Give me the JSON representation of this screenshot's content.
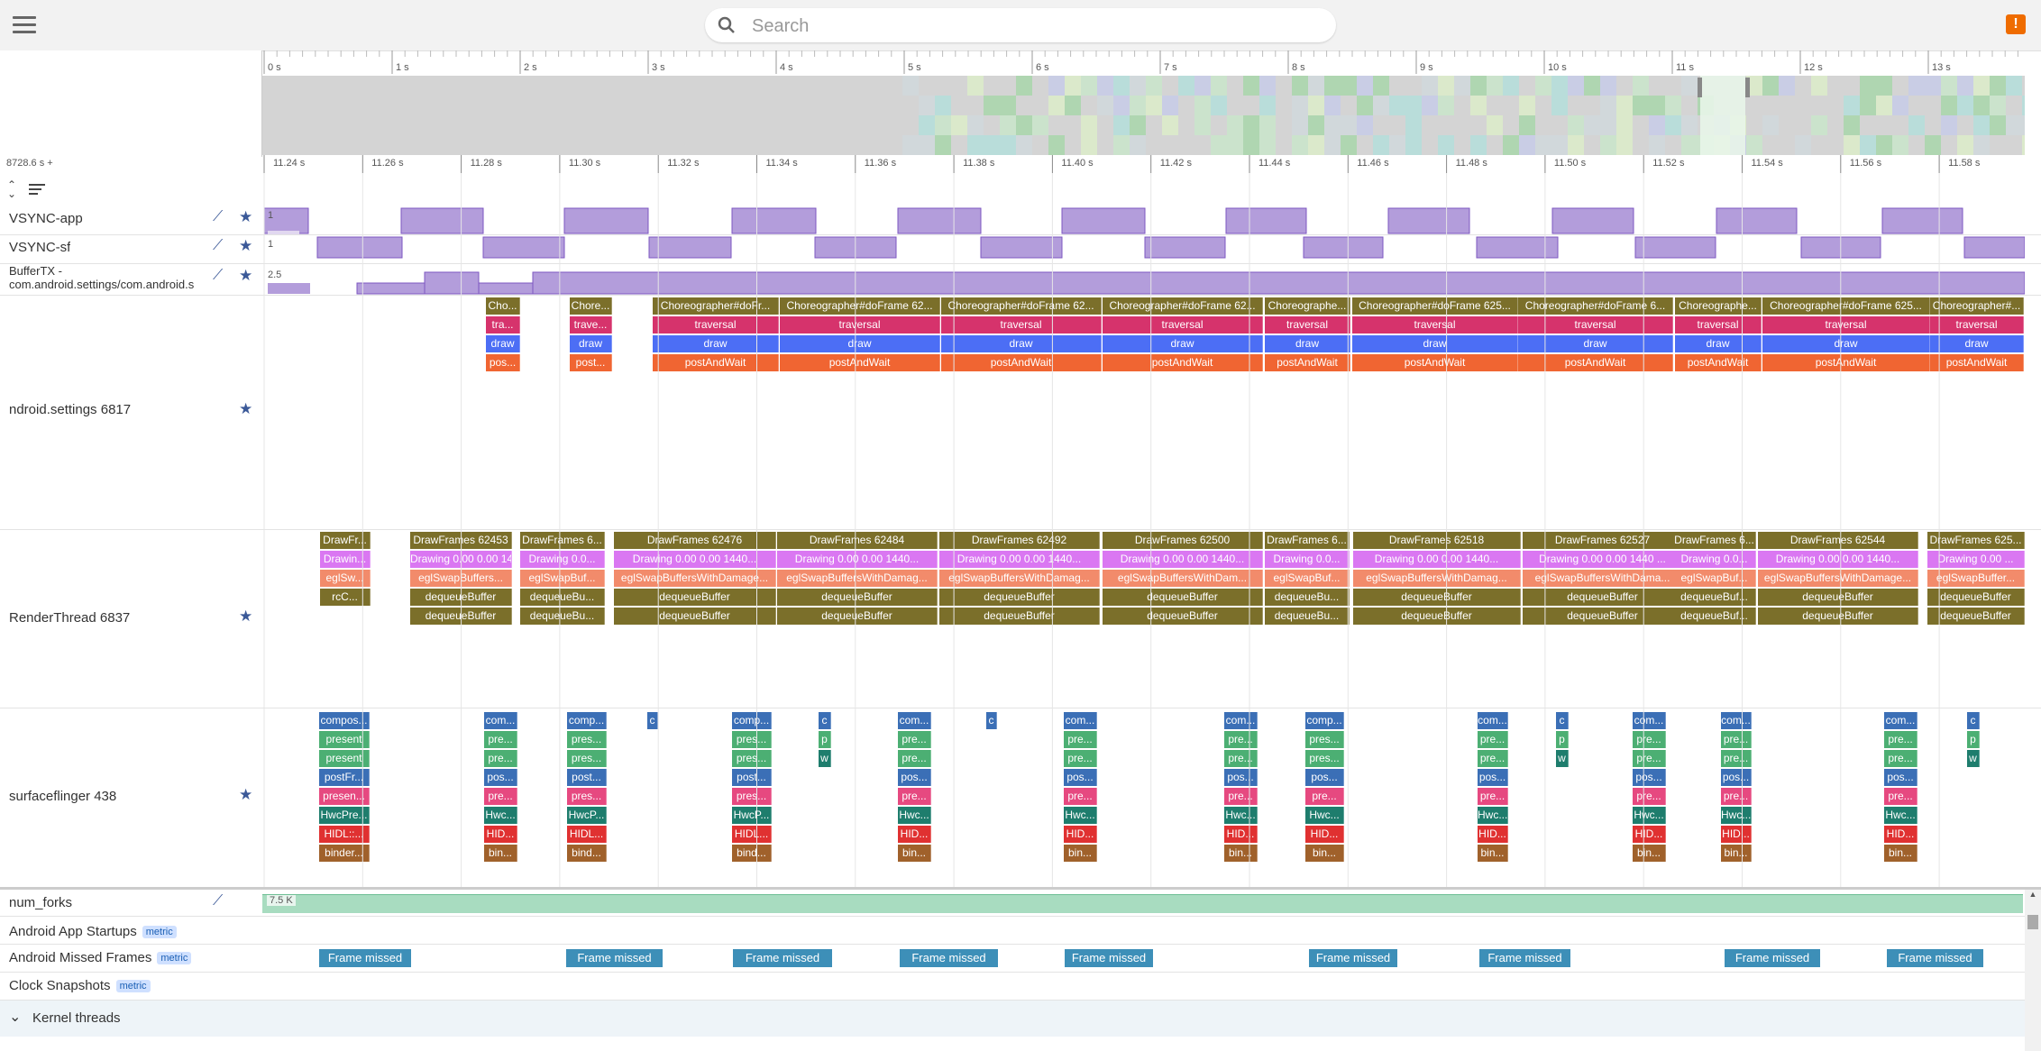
{
  "search": {
    "placeholder": "Search"
  },
  "alert_icon": "!",
  "overview": {
    "ticks": [
      "0 s",
      "1 s",
      "2 s",
      "3 s",
      "4 s",
      "5 s",
      "6 s",
      "7 s",
      "8 s",
      "9 s",
      "10 s",
      "11 s",
      "12 s",
      "13 s"
    ]
  },
  "timeline": {
    "offset": "8728.6 s +",
    "ticks": [
      "11.24 s",
      "11.26 s",
      "11.28 s",
      "11.30 s",
      "11.32 s",
      "11.34 s",
      "11.36 s",
      "11.38 s",
      "11.40 s",
      "11.42 s",
      "11.44 s",
      "11.46 s",
      "11.48 s",
      "11.50 s",
      "11.52 s",
      "11.54 s",
      "11.56 s",
      "11.58 s"
    ]
  },
  "tracks": {
    "vsync_app": {
      "label": "VSYNC-app",
      "value": "1"
    },
    "vsync_sf": {
      "label": "VSYNC-sf",
      "value": "1"
    },
    "buffertx": {
      "label": "BufferTX - com.android.settings/com.android.s",
      "value": "2.5"
    },
    "settings": {
      "label": "ndroid.settings 6817"
    },
    "renderthread": {
      "label": "RenderThread 6837"
    },
    "surfaceflinger": {
      "label": "surfaceflinger 438"
    },
    "num_forks": {
      "label": "num_forks",
      "value": "7.5 K"
    },
    "app_startups": {
      "label": "Android App Startups",
      "badge": "metric"
    },
    "missed_frames": {
      "label": "Android Missed Frames",
      "badge": "metric",
      "frame_label": "Frame missed"
    },
    "clock_snapshots": {
      "label": "Clock Snapshots",
      "badge": "metric"
    },
    "kernel_threads": {
      "label": "Kernel threads"
    }
  },
  "main_thread_slices": [
    {
      "l": [
        "Cho...",
        "tra...",
        "draw",
        "pos..."
      ]
    },
    {
      "l": [
        "Chore...",
        "trave...",
        "draw",
        "post..."
      ]
    },
    {
      "l": [
        "Choreographer#doFr...",
        "traversal",
        "draw",
        "postAndWait"
      ]
    },
    {
      "l": [
        "Choreographer#doFrame 62...",
        "traversal",
        "draw",
        "postAndWait"
      ]
    },
    {
      "l": [
        "Choreographer#doFrame 62...",
        "traversal",
        "draw",
        "postAndWait"
      ]
    },
    {
      "l": [
        "Choreographer#doFrame 62...",
        "traversal",
        "draw",
        "postAndWait"
      ]
    },
    {
      "l": [
        "Choreographe...",
        "traversal",
        "draw",
        "postAndWait"
      ]
    },
    {
      "l": [
        "Choreographer#doFrame 625...",
        "traversal",
        "draw",
        "postAndWait"
      ]
    },
    {
      "l": [
        "Choreographer#doFrame 6...",
        "traversal",
        "draw",
        "postAndWait"
      ]
    },
    {
      "l": [
        "Choreographe...",
        "traversal",
        "draw",
        "postAndWait"
      ]
    },
    {
      "l": [
        "Choreographer#doFrame 625...",
        "traversal",
        "draw",
        "postAndWait"
      ]
    },
    {
      "l": [
        "Choreographer#...",
        "traversal",
        "draw",
        "postAndWait"
      ]
    }
  ],
  "render_slices": [
    {
      "l": [
        "DrawFr...",
        "Drawin...",
        "eglSw...",
        "rcC..."
      ]
    },
    {
      "l": [
        "DrawFrames 62453",
        "Drawing  0.00  0.00 1440...",
        "eglSwapBuffers...",
        "dequeueBuffer",
        "dequeueBuffer"
      ]
    },
    {
      "l": [
        "DrawFrames 6...",
        "Drawing  0.0...",
        "eglSwapBuf...",
        "dequeueBu...",
        "dequeueBu..."
      ]
    },
    {
      "l": [
        "DrawFrames 62476",
        "Drawing  0.00  0.00 1440...",
        "eglSwapBuffersWithDamage...",
        "dequeueBuffer",
        "dequeueBuffer"
      ]
    },
    {
      "l": [
        "DrawFrames 62484",
        "Drawing  0.00  0.00 1440...",
        "eglSwapBuffersWithDamag...",
        "dequeueBuffer",
        "dequeueBuffer"
      ]
    },
    {
      "l": [
        "DrawFrames 62492",
        "Drawing  0.00  0.00 1440...",
        "eglSwapBuffersWithDamag...",
        "dequeueBuffer",
        "dequeueBuffer"
      ]
    },
    {
      "l": [
        "DrawFrames 62500",
        "Drawing  0.00  0.00 1440...",
        "eglSwapBuffersWithDam...",
        "dequeueBuffer",
        "dequeueBuffer"
      ]
    },
    {
      "l": [
        "DrawFrames 6...",
        "Drawing  0.0...",
        "eglSwapBuf...",
        "dequeueBu...",
        "dequeueBu..."
      ]
    },
    {
      "l": [
        "DrawFrames 62518",
        "Drawing  0.00  0.00 1440...",
        "eglSwapBuffersWithDamag...",
        "dequeueBuffer",
        "dequeueBuffer"
      ]
    },
    {
      "l": [
        "DrawFrames 62527",
        "Drawing  0.00  0.00 1440 ...",
        "eglSwapBuffersWithDama...",
        "dequeueBuffer",
        "dequeueBuffer"
      ]
    },
    {
      "l": [
        "DrawFrames 6...",
        "Drawing  0.0...",
        "eglSwapBuf...",
        "dequeueBuf...",
        "dequeueBuf..."
      ]
    },
    {
      "l": [
        "DrawFrames 62544",
        "Drawing  0.00  0.00 1440...",
        "eglSwapBuffersWithDamage...",
        "dequeueBuffer",
        "dequeueBuffer"
      ]
    },
    {
      "l": [
        "DrawFrames 625...",
        "Drawing  0.00 ...",
        "eglSwapBuffer...",
        "dequeueBuffer",
        "dequeueBuffer"
      ]
    }
  ],
  "sf_slices": [
    {
      "l": [
        "compos...",
        "present",
        "present",
        "postFr...",
        "presen...",
        "HwcPre...",
        "HIDL::...",
        "binder..."
      ]
    },
    {
      "l": [
        "com...",
        "pre...",
        "pre...",
        "pos...",
        "pre...",
        "Hwc...",
        "HID...",
        "bin..."
      ]
    },
    {
      "l": [
        "comp...",
        "pres...",
        "pres...",
        "post...",
        "pres...",
        "HwcP...",
        "HIDL...",
        "bind..."
      ]
    },
    {
      "l": [
        "comp...",
        "pres...",
        "pres...",
        "post...",
        "pres...",
        "HwcP...",
        "HIDL...",
        "bind..."
      ]
    },
    {
      "l": [
        "com...",
        "pre...",
        "pre...",
        "pos...",
        "pre...",
        "Hwc...",
        "HID...",
        "bin..."
      ]
    },
    {
      "l": [
        "com...",
        "pre...",
        "pre...",
        "pos...",
        "pre...",
        "Hwc...",
        "HID...",
        "bin..."
      ]
    },
    {
      "l": [
        "com...",
        "pre...",
        "pre...",
        "pos...",
        "pre...",
        "Hwc...",
        "HID...",
        "bin..."
      ]
    },
    {
      "l": [
        "comp...",
        "pres...",
        "pres...",
        "pos...",
        "pre...",
        "Hwc...",
        "HID...",
        "bin..."
      ]
    },
    {
      "l": [
        "com...",
        "pre...",
        "pre...",
        "pos...",
        "pre...",
        "Hwc...",
        "HID...",
        "bin..."
      ]
    },
    {
      "l": [
        "com...",
        "pre...",
        "pre...",
        "pos...",
        "pre...",
        "Hwc...",
        "HID...",
        "bin..."
      ]
    },
    {
      "l": [
        "com...",
        "pre...",
        "pre...",
        "pos...",
        "pre...",
        "Hwc...",
        "HID...",
        "bin..."
      ]
    },
    {
      "l": [
        "com...",
        "pre...",
        "pre...",
        "pos...",
        "pre...",
        "Hwc...",
        "HID...",
        "bin..."
      ]
    }
  ],
  "sf_small": [
    {
      "l": [
        "c"
      ]
    },
    {
      "l": [
        "c"
      ]
    },
    {
      "l": [
        "c",
        "p",
        "w"
      ]
    },
    {
      "l": [
        "c",
        "p",
        "w"
      ]
    },
    {
      "l": [
        "c",
        "p",
        "w"
      ]
    }
  ],
  "colors": {
    "vsync": "#b39ddb",
    "vsync_border": "#7e57c2",
    "choreo": "#7b6f2a",
    "traversal": "#d6336c",
    "draw": "#4c6ef5",
    "postandwait": "#f06532",
    "drawframes": "#7b6f2a",
    "drawing": "#da77f2",
    "eglswap": "#f28b6b",
    "dequeue": "#7b6f2a",
    "sf_comp": "#3b6fb6",
    "sf_present": "#4caf73",
    "sf_pos": "#3b6fb6",
    "sf_pres2": "#e64980",
    "sf_hwc": "#1e7d6d",
    "sf_hidl": "#e03131",
    "sf_binder": "#a0612b",
    "missed": "#3d8fb8",
    "numforks": "#a8dcc0"
  }
}
